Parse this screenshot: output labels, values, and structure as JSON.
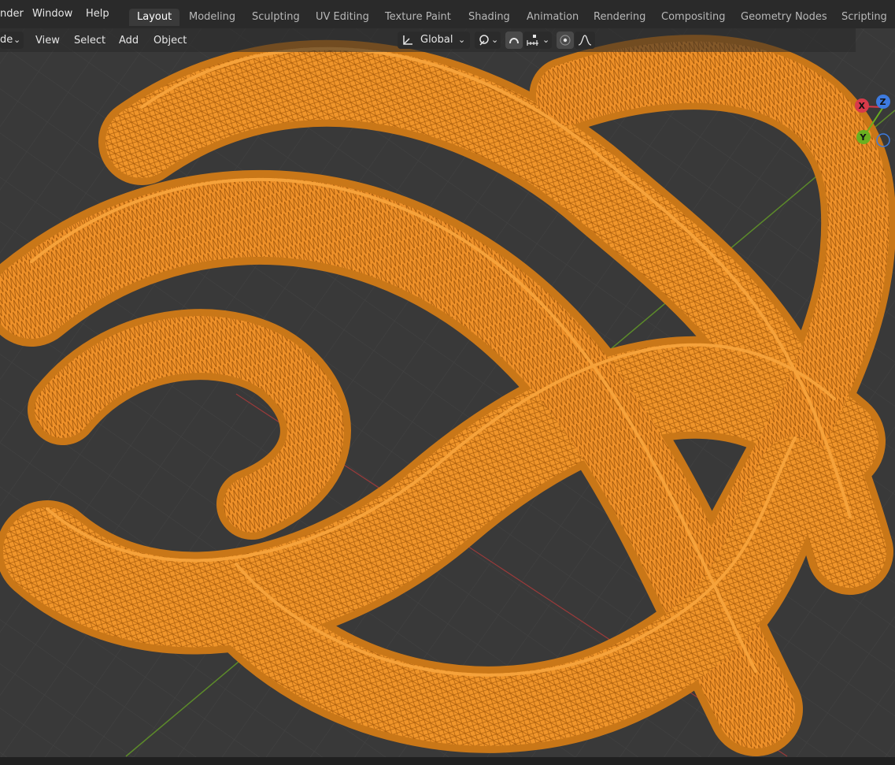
{
  "topbar": {
    "menus": [
      "nder",
      "Window",
      "Help"
    ],
    "workspaces": [
      "Layout",
      "Modeling",
      "Sculpting",
      "UV Editing",
      "Texture Paint",
      "Shading",
      "Animation",
      "Rendering",
      "Compositing",
      "Geometry Nodes",
      "Scripting"
    ],
    "active_workspace": "Layout"
  },
  "viewport_header": {
    "mode_label": "de",
    "menus": [
      "View",
      "Select",
      "Add",
      "Object"
    ],
    "transform_orientation": "Global"
  },
  "gizmo": {
    "x": "X",
    "y": "Y",
    "z": "Z"
  },
  "colors": {
    "mesh": "#f0952a",
    "wire": "#b86810",
    "grid": "#414141",
    "background": "#393939"
  }
}
